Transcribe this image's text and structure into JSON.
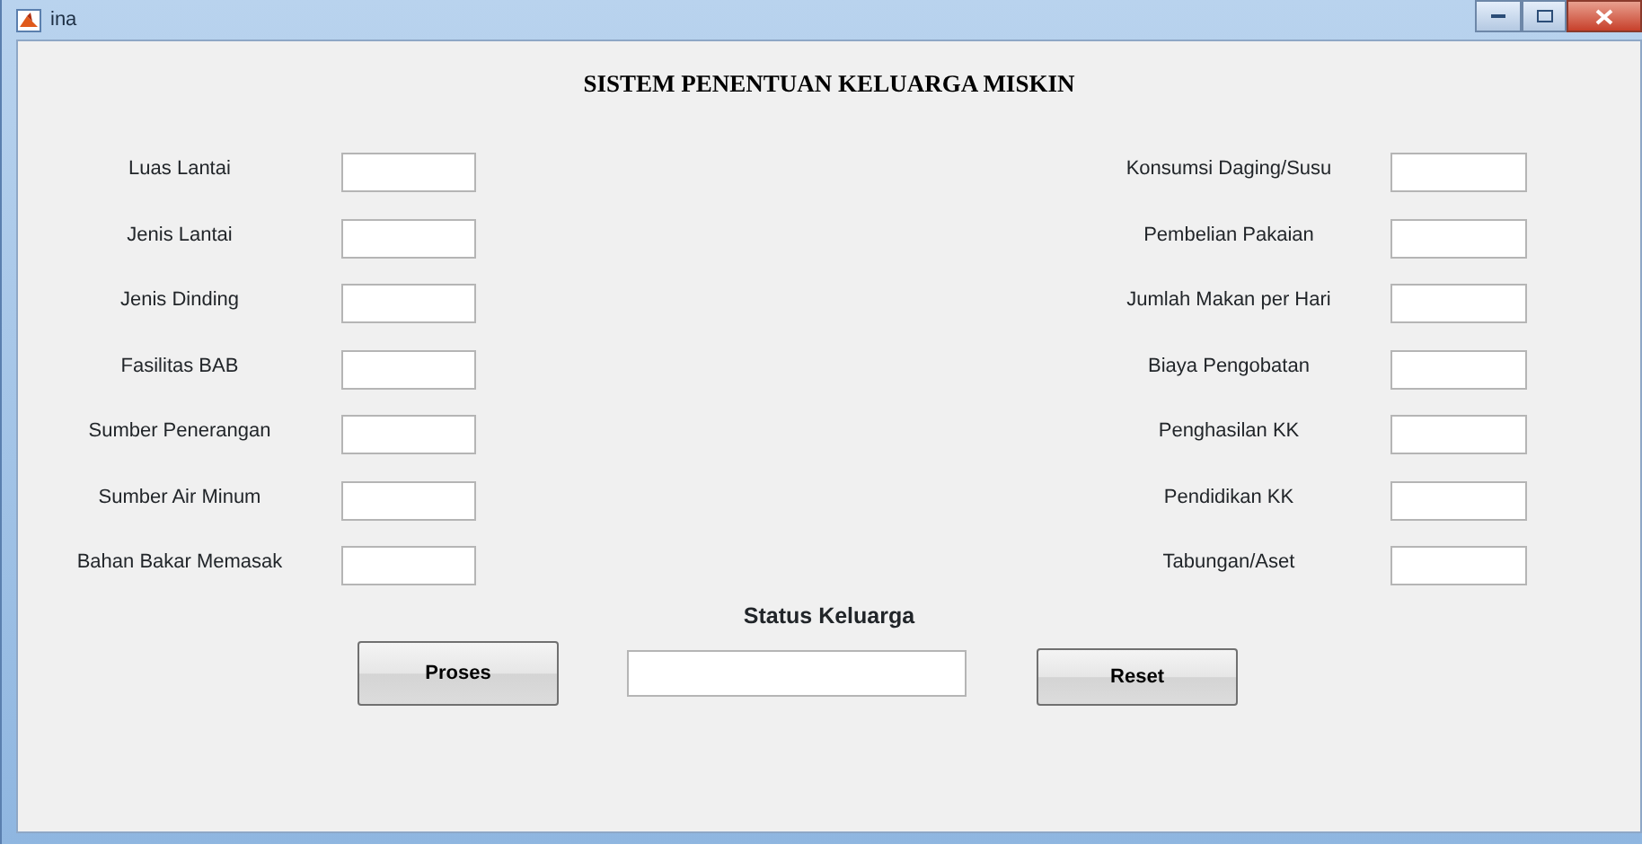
{
  "window": {
    "title": "ina"
  },
  "heading": "SISTEM PENENTUAN KELUARGA MISKIN",
  "left_fields": [
    {
      "label": "Luas Lantai"
    },
    {
      "label": "Jenis Lantai"
    },
    {
      "label": "Jenis Dinding"
    },
    {
      "label": "Fasilitas BAB"
    },
    {
      "label": "Sumber Penerangan"
    },
    {
      "label": "Sumber Air Minum"
    },
    {
      "label": "Bahan Bakar Memasak"
    }
  ],
  "right_fields": [
    {
      "label": "Konsumsi Daging/Susu"
    },
    {
      "label": "Pembelian Pakaian"
    },
    {
      "label": "Jumlah Makan per Hari"
    },
    {
      "label": "Biaya Pengobatan"
    },
    {
      "label": "Penghasilan KK"
    },
    {
      "label": "Pendidikan KK"
    },
    {
      "label": "Tabungan/Aset"
    }
  ],
  "status": {
    "label": "Status Keluarga"
  },
  "buttons": [
    {
      "label": "Proses"
    },
    {
      "label": "Reset"
    }
  ]
}
